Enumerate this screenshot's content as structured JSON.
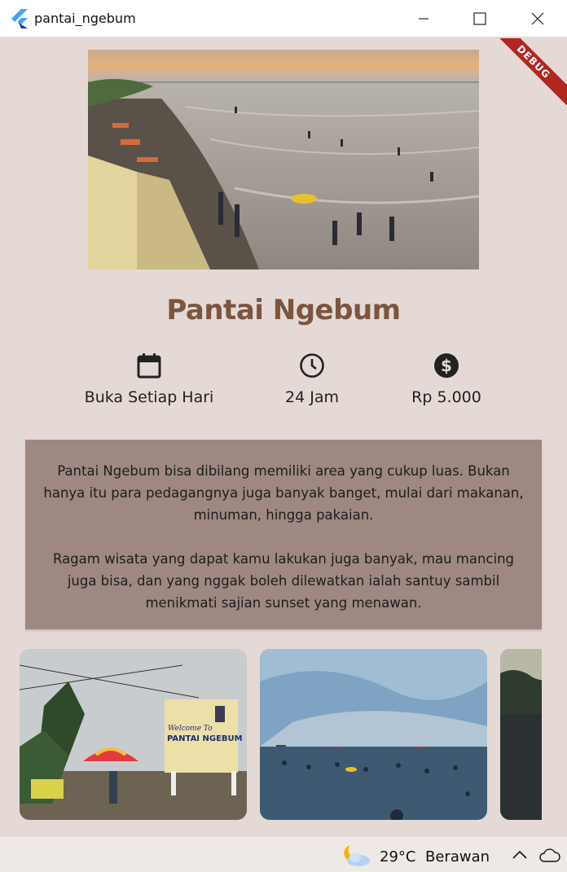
{
  "window": {
    "title": "pantai_ngebum",
    "debug_label": "DEBUG"
  },
  "page": {
    "title": "Pantai Ngebum"
  },
  "info": [
    {
      "icon": "calendar-icon",
      "text": "Buka Setiap Hari"
    },
    {
      "icon": "clock-icon",
      "text": "24 Jam"
    },
    {
      "icon": "dollar-icon",
      "text": "Rp 5.000"
    }
  ],
  "description": {
    "p1": "Pantai Ngebum bisa dibilang memiliki area yang cukup luas. Bukan hanya itu para pedagangnya juga banyak banget, mulai dari makanan, minuman, hingga pakaian.",
    "p2": "Ragam wisata yang dapat kamu lakukan juga banyak, mau mancing juga bisa, dan yang nggak boleh dilewatkan ialah santuy sambil menikmati sajian sunset yang menawan."
  },
  "gallery_sign": {
    "line1": "Welcome To",
    "line2": "PANTAI NGEBUM"
  },
  "taskbar": {
    "temperature": "29°C",
    "condition": "Berawan"
  },
  "colors": {
    "title": "#7b5540",
    "background": "#e4d9d5",
    "description_box": "#9e8881",
    "debug_banner": "#b3261e"
  }
}
